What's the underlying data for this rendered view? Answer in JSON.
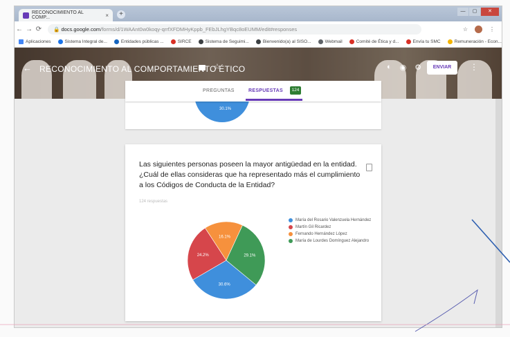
{
  "browser": {
    "tab_title": "RECONOCIMIENTO AL COMP...",
    "tab_close": "×",
    "new_tab": "+",
    "url_host": "docs.google.com",
    "url_path": "/forms/d/1WAAnt0w0koqy-qrrfXFDMHyKppb_FEbJLhgYBqc8oEUMM/edit#responses",
    "window_controls": [
      "—",
      "▢",
      "✕"
    ],
    "bookmarks": [
      {
        "label": "Aplicaciones",
        "color": "#4285f4"
      },
      {
        "label": "Sistema Integral de...",
        "color": "#1a73e8"
      },
      {
        "label": "Entidades públicas ...",
        "color": "#1565c0"
      },
      {
        "label": "SIRCE",
        "color": "#d93025"
      },
      {
        "label": "Sistema de Seguimi...",
        "color": "#3c4043"
      },
      {
        "label": "Bienvenido(a) al SISO...",
        "color": "#3c4043"
      },
      {
        "label": "Webmail",
        "color": "#5f6368"
      },
      {
        "label": "Comité de Ética y d...",
        "color": "#d93025"
      },
      {
        "label": "Envía tu SMC",
        "color": "#d93025"
      },
      {
        "label": "Remuneración - Econ...",
        "color": "#f4b400"
      }
    ]
  },
  "header": {
    "title": "RECONOCIMIENTO AL COMPORTAMIENTO ÉTICO",
    "send_label": "ENVIAR"
  },
  "tabs": {
    "questions_label": "PREGUNTAS",
    "responses_label": "RESPUESTAS",
    "responses_count": "124"
  },
  "question": {
    "text": "Las siguientes personas poseen la mayor antigüedad en la entidad. ¿Cuál de ellas consideras que ha representado más el cumplimiento a los Códigos de Conducta de la Entidad?",
    "response_count": "124 respuestas"
  },
  "chart_data": {
    "type": "pie",
    "title": "",
    "labels": [
      "María del Rosario Valenzuela Hernández",
      "Martín Gil Ricardez",
      "Fernando Hernández López",
      "María de Lourdes Domínguez Alejandro"
    ],
    "values": [
      30.6,
      24.2,
      16.1,
      29.1
    ],
    "value_labels": [
      "30.6%",
      "24.2%",
      "16.1%",
      "29.1%"
    ],
    "colors": [
      "#3f8fdc",
      "#d6464b",
      "#f6913d",
      "#3f9a57"
    ],
    "legend_position": "right"
  },
  "top_chart_partial": {
    "value_label": "30.1%",
    "color": "#3f8fdc"
  }
}
